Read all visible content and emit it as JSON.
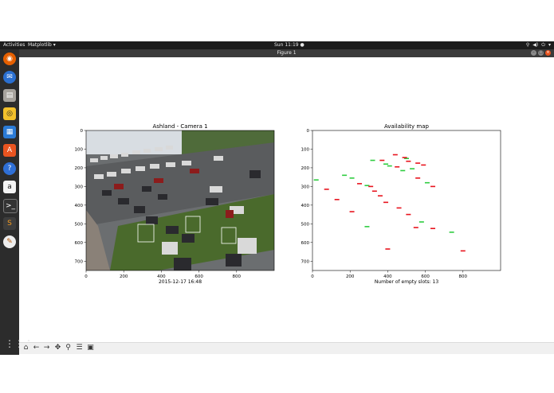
{
  "topbar": {
    "activities": "Activities",
    "app_menu": "Matplotlib ▾",
    "clock": "Sun 11:19 ●"
  },
  "window": {
    "title": "Figure 1"
  },
  "dock": {
    "icons": [
      "firefox-icon",
      "thunderbird-icon",
      "files-icon",
      "rhythmbox-icon",
      "libreoffice-writer-icon",
      "software-center-icon",
      "help-icon",
      "amazon-icon",
      "terminal-icon",
      "sublime-text-icon",
      "system-settings-icon"
    ]
  },
  "left_plot": {
    "title": "Ashland - Camera 1",
    "xlabel": "2015-12-17 16:48",
    "xticks": [
      "0",
      "200",
      "400",
      "600",
      "800"
    ],
    "yticks": [
      "0",
      "100",
      "200",
      "300",
      "400",
      "500",
      "600",
      "700"
    ]
  },
  "right_plot": {
    "title": "Availability map",
    "xlabel": "Number of empty slots: 13",
    "xticks": [
      "0",
      "200",
      "400",
      "600",
      "800"
    ],
    "yticks": [
      "0",
      "100",
      "200",
      "300",
      "400",
      "500",
      "600",
      "700"
    ]
  },
  "chart_data": {
    "type": "scatter",
    "title": "Availability map",
    "xlabel": "Number of empty slots: 13",
    "xlim": [
      0,
      1000
    ],
    "ylim": [
      750,
      0
    ],
    "colors": {
      "empty": "#2ecc40",
      "occupied": "#e8141e"
    },
    "series": [
      {
        "values": [
          [
            20,
            265
          ],
          [
            170,
            240
          ],
          [
            210,
            255
          ],
          [
            290,
            295
          ],
          [
            320,
            160
          ],
          [
            390,
            180
          ],
          [
            410,
            190
          ],
          [
            480,
            215
          ],
          [
            500,
            150
          ],
          [
            530,
            205
          ],
          [
            610,
            280
          ],
          [
            580,
            490
          ],
          [
            290,
            515
          ],
          [
            740,
            545
          ]
        ]
      },
      {
        "values": [
          [
            75,
            315
          ],
          [
            130,
            370
          ],
          [
            210,
            435
          ],
          [
            250,
            285
          ],
          [
            310,
            300
          ],
          [
            330,
            325
          ],
          [
            360,
            350
          ],
          [
            370,
            160
          ],
          [
            390,
            385
          ],
          [
            440,
            130
          ],
          [
            450,
            195
          ],
          [
            460,
            415
          ],
          [
            490,
            145
          ],
          [
            510,
            165
          ],
          [
            510,
            450
          ],
          [
            550,
            520
          ],
          [
            560,
            175
          ],
          [
            590,
            185
          ],
          [
            560,
            255
          ],
          [
            640,
            300
          ],
          [
            640,
            525
          ],
          [
            400,
            635
          ],
          [
            800,
            645
          ]
        ]
      }
    ]
  },
  "toolbar": {
    "buttons": [
      "home-icon",
      "back-icon",
      "forward-icon",
      "pan-icon",
      "zoom-icon",
      "configure-subplots-icon",
      "save-icon"
    ]
  }
}
